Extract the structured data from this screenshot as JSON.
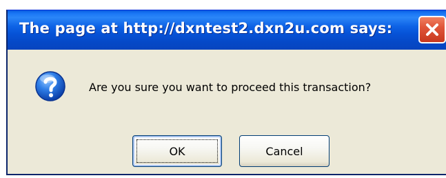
{
  "dialog": {
    "title": "The page at http://dxntest2.dxn2u.com says:",
    "message": "Are you sure you want to proceed this transaction?",
    "icon": "question-icon",
    "buttons": {
      "ok_label": "OK",
      "cancel_label": "Cancel"
    },
    "focused_button": "OK"
  },
  "colors": {
    "title_bar": "#0a5ce0",
    "close_button": "#e0563a",
    "dialog_background": "#ece9d8",
    "button_border": "#003c74"
  }
}
